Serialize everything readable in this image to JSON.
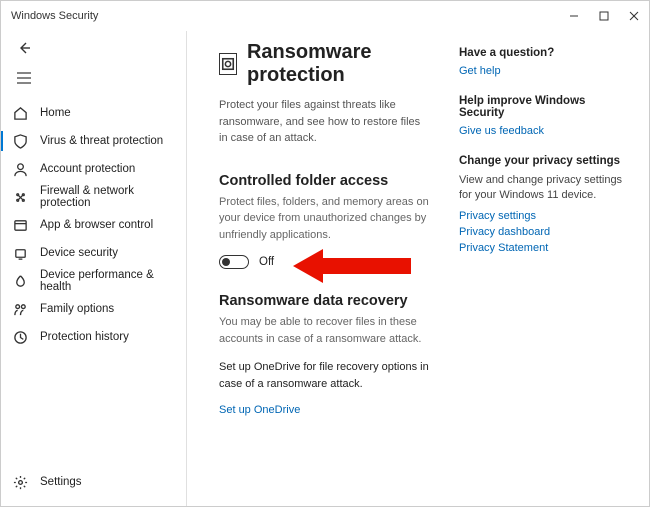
{
  "window": {
    "title": "Windows Security"
  },
  "sidebar": {
    "items": [
      {
        "label": "Home"
      },
      {
        "label": "Virus & threat protection"
      },
      {
        "label": "Account protection"
      },
      {
        "label": "Firewall & network protection"
      },
      {
        "label": "App & browser control"
      },
      {
        "label": "Device security"
      },
      {
        "label": "Device performance & health"
      },
      {
        "label": "Family options"
      },
      {
        "label": "Protection history"
      }
    ],
    "settings_label": "Settings"
  },
  "page": {
    "title": "Ransomware protection",
    "intro": "Protect your files against threats like ransomware, and see how to restore files in case of an attack.",
    "cfa": {
      "heading": "Controlled folder access",
      "desc": "Protect files, folders, and memory areas on your device from unauthorized changes by unfriendly applications.",
      "toggle_state": "Off"
    },
    "recovery": {
      "heading": "Ransomware data recovery",
      "desc": "You may be able to recover files in these accounts in case of a ransomware attack.",
      "onedrive_prompt": "Set up OneDrive for file recovery options in case of a ransomware attack.",
      "onedrive_link": "Set up OneDrive"
    }
  },
  "aside": {
    "question": {
      "heading": "Have a question?",
      "link": "Get help"
    },
    "improve": {
      "heading": "Help improve Windows Security",
      "link": "Give us feedback"
    },
    "privacy": {
      "heading": "Change your privacy settings",
      "desc": "View and change privacy settings for your Windows 11 device.",
      "links": [
        "Privacy settings",
        "Privacy dashboard",
        "Privacy Statement"
      ]
    }
  }
}
